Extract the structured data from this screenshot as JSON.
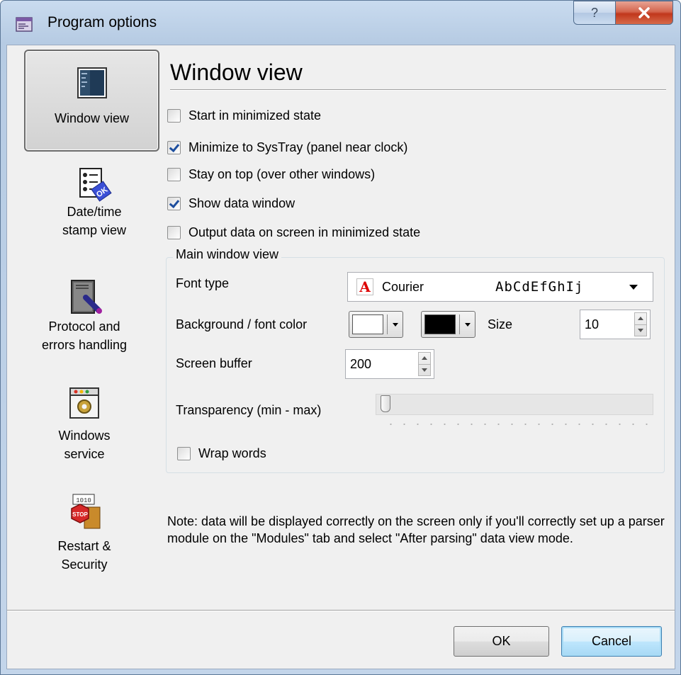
{
  "window": {
    "title": "Program options",
    "help_glyph": "?",
    "close_glyph": "X"
  },
  "nav": {
    "items": [
      {
        "id": "window-view",
        "label": "Window view",
        "icon": "window-view-icon",
        "selected": true
      },
      {
        "id": "date-time",
        "label": "Date/time\nstamp view",
        "icon": "date-time-stamp-icon",
        "selected": false
      },
      {
        "id": "protocol",
        "label": "Protocol and\nerrors handling",
        "icon": "protocol-errors-icon",
        "selected": false
      },
      {
        "id": "service",
        "label": "Windows\nservice",
        "icon": "windows-service-icon",
        "selected": false
      },
      {
        "id": "restart",
        "label": "Restart &\nSecurity",
        "icon": "restart-security-icon",
        "selected": false
      }
    ]
  },
  "panel": {
    "title": "Window view",
    "checkboxes": [
      {
        "label": "Start in minimized state",
        "checked": false
      },
      {
        "label": "Minimize to SysTray (panel near clock)",
        "checked": true
      },
      {
        "label": "Stay on top (over other windows)",
        "checked": false
      },
      {
        "label": "Show data window",
        "checked": true
      },
      {
        "label": "Output data on screen in minimized state",
        "checked": false
      }
    ],
    "group": {
      "legend": "Main window view",
      "font_type_label": "Font type",
      "font_name": "Courier",
      "font_sample": "AbCdEfGhIj",
      "font_icon_glyph": "A",
      "color_label": "Background / font color",
      "background_color": "#ffffff",
      "font_color": "#000000",
      "size_label": "Size",
      "size_value": "10",
      "buffer_label": "Screen buffer",
      "buffer_value": "200",
      "transparency_label": "Transparency (min - max)",
      "transparency_value": 0,
      "wrap_label": "Wrap words",
      "wrap_checked": false
    },
    "note": "Note: data will be displayed correctly on the screen only if you'll correctly set up a parser module on the \"Modules\" tab and select \"After parsing\" data view mode."
  },
  "buttons": {
    "ok": "OK",
    "cancel": "Cancel"
  }
}
